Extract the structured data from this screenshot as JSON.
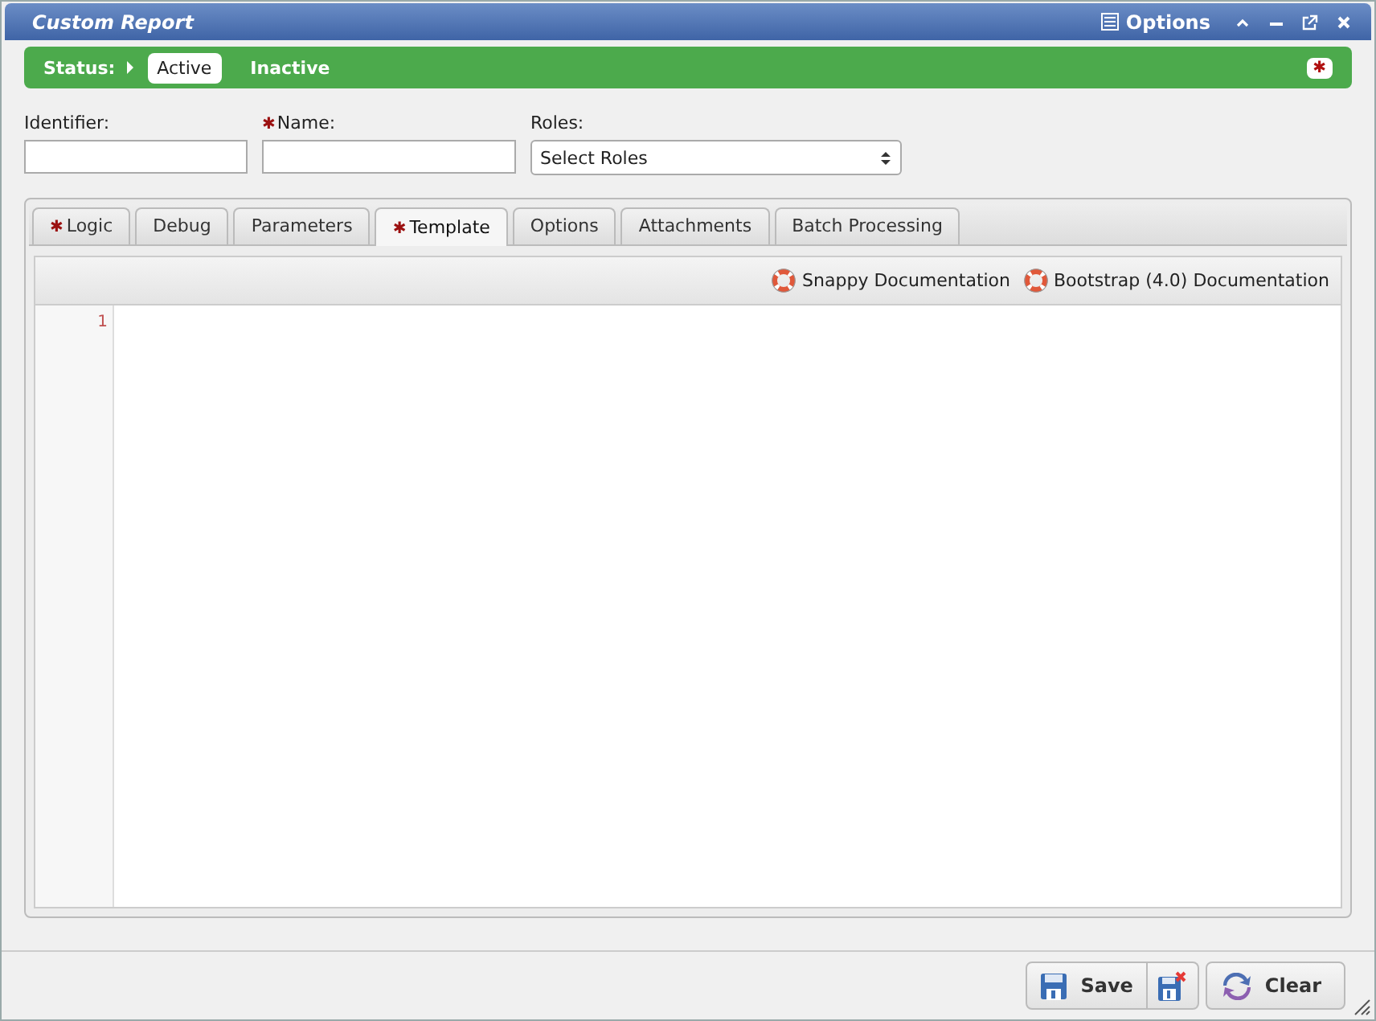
{
  "window": {
    "title": "Custom Report",
    "options_label": "Options"
  },
  "status": {
    "label": "Status:",
    "options": [
      {
        "label": "Active",
        "selected": true
      },
      {
        "label": "Inactive",
        "selected": false
      }
    ],
    "required_mark": "✱"
  },
  "fields": [
    {
      "label": "Identifier:",
      "required": false,
      "kind": "text"
    },
    {
      "label": "Name:",
      "required": true,
      "kind": "text"
    },
    {
      "label": "Roles:",
      "required": false,
      "kind": "select",
      "placeholder": "Select Roles"
    }
  ],
  "tabs": [
    {
      "label": "Logic",
      "required": true,
      "selected": false
    },
    {
      "label": "Debug",
      "required": false,
      "selected": false
    },
    {
      "label": "Parameters",
      "required": false,
      "selected": false
    },
    {
      "label": "Template",
      "required": true,
      "selected": true
    },
    {
      "label": "Options",
      "required": false,
      "selected": false
    },
    {
      "label": "Attachments",
      "required": false,
      "selected": false
    },
    {
      "label": "Batch Processing",
      "required": false,
      "selected": false
    }
  ],
  "doc_links": [
    "Snappy Documentation",
    "Bootstrap (4.0) Documentation"
  ],
  "editor": {
    "line_numbers": [
      "1"
    ]
  },
  "buttons": [
    {
      "label": "Save",
      "kind": "save"
    },
    {
      "kind": "discard"
    },
    {
      "label": "Clear",
      "kind": "clear"
    }
  ]
}
